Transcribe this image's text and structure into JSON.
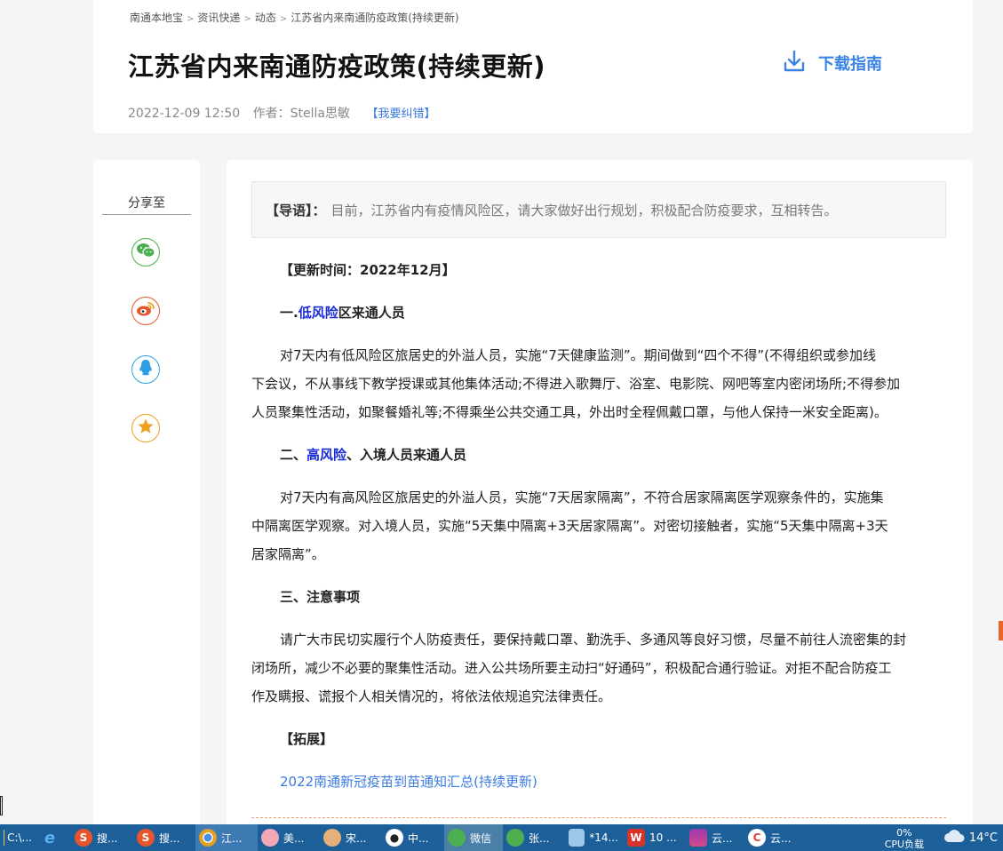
{
  "breadcrumb": {
    "items": [
      "南通本地宝",
      "资讯快递",
      "动态",
      "江苏省内来南通防疫政策(持续更新)"
    ],
    "separator": ">"
  },
  "article": {
    "title": "江苏省内来南通防疫政策(持续更新)",
    "date": "2022-12-09 12:50",
    "author": "作者：Stella思敏",
    "report_link": "【我要纠错】",
    "download_label": "下载指南"
  },
  "share": {
    "title": "分享至",
    "buttons": [
      {
        "name": "wechat",
        "icon": "wechat-icon",
        "color": "#4caf50"
      },
      {
        "name": "weibo",
        "icon": "weibo-icon",
        "color": "#e8562f"
      },
      {
        "name": "qq",
        "icon": "qq-icon",
        "color": "#2d9fe0"
      },
      {
        "name": "qzone",
        "icon": "star-icon",
        "color": "#f0a020"
      }
    ]
  },
  "lead": {
    "label": "【导语】：",
    "text": "目前，江苏省内有疫情风险区，请大家做好出行规划，积极配合防疫要求，互相转告。"
  },
  "content": {
    "update_time": "【更新时间：2022年12月】",
    "s1": {
      "prefix": "一.",
      "highlight": "低风险",
      "suffix": "区来通人员"
    },
    "p1": [
      "对7天内有低风险区旅居史的外溢人员，实施“7天健康监测”。期间做到“四个不得”(不得组织或参加线",
      "下会议，不从事线下教学授课或其他集体活动;不得进入歌舞厅、浴室、电影院、网吧等室内密闭场所;不得参加",
      "人员聚集性活动，如聚餐婚礼等;不得乘坐公共交通工具，外出时全程佩戴口罩，与他人保持一米安全距离)。"
    ],
    "s2": {
      "prefix": "二、",
      "highlight": "高风险",
      "suffix": "、入境人员来通人员"
    },
    "p2": [
      "对7天内有高风险区旅居史的外溢人员，实施“7天居家隔离”，不符合居家隔离医学观察条件的，实施集",
      "中隔离医学观察。对入境人员，实施“5天集中隔离+3天居家隔离”。对密切接触者，实施“5天集中隔离+3天",
      "居家隔离”。"
    ],
    "s3": "三、注意事项",
    "p3": [
      "请广大市民切实履行个人防疫责任，要保持戴口罩、勤洗手、多通风等良好习惯，尽量不前往人流密集的封",
      "闭场所，减少不必要的聚集性活动。进入公共场所要主动扫“好通码”，积极配合通行验证。对拒不配合防疫工",
      "作及瞒报、谎报个人相关情况的，将依法依规追究法律责任。"
    ],
    "ext_title": "【拓展】",
    "ext_link": "2022南通新冠疫苗到苗通知汇总(持续更新)"
  },
  "taskbar": {
    "items": [
      {
        "icon": "folder-icon",
        "label": "C:\\...",
        "color": "#f2c14e"
      },
      {
        "icon": "ie-icon",
        "label": "",
        "color": "#2a8ad8"
      },
      {
        "icon": "sogou-icon",
        "label": "搜...",
        "color": "#e8552d"
      },
      {
        "icon": "sogou-icon",
        "label": "搜...",
        "color": "#e8552d"
      },
      {
        "icon": "chrome-icon",
        "label": "江...",
        "color": "#e0a020"
      },
      {
        "icon": "meitu-icon",
        "label": "美...",
        "color": "#f3a8b8"
      },
      {
        "icon": "song-icon",
        "label": "宋...",
        "color": "#e6b07a"
      },
      {
        "icon": "penguin-icon",
        "label": "中...",
        "color": "#222222"
      },
      {
        "icon": "wechat-icon",
        "label": "微信",
        "color": "#4caf50"
      },
      {
        "icon": "wechat-icon",
        "label": "张...",
        "color": "#4caf50"
      },
      {
        "icon": "notepad-icon",
        "label": "*14...",
        "color": "#9ec6e8"
      },
      {
        "icon": "wps-icon",
        "label": "10 ...",
        "color": "#d9322b"
      },
      {
        "icon": "winrar-icon",
        "label": "云...",
        "color": "#9c3ab0"
      },
      {
        "icon": "cloud-app-icon",
        "label": "云...",
        "color": "#e04040"
      }
    ],
    "cpu_percent": "0%",
    "cpu_label": "CPU负载",
    "temperature": "14°C"
  }
}
